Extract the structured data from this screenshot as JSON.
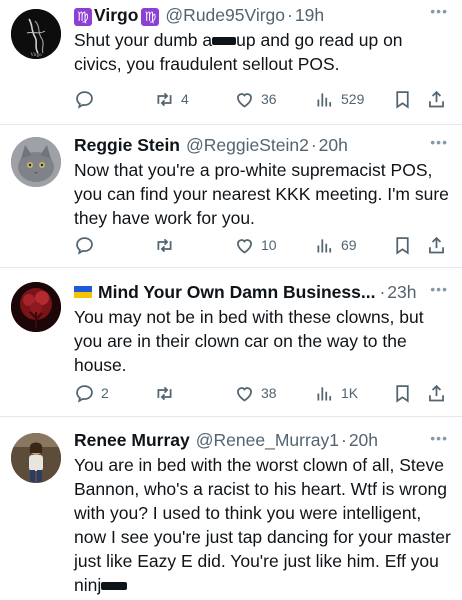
{
  "tweets": [
    {
      "name": "Virgo",
      "handle": "@Rude95Virgo",
      "time": "19h",
      "text_parts": [
        "Shut your dumb a",
        "up and go read up on civics, you fraudulent sellout POS."
      ],
      "replies": "",
      "retweets": "4",
      "likes": "36",
      "views": "529",
      "avatar_text": "Virgo"
    },
    {
      "name": "Reggie Stein",
      "handle": "@ReggieStein2",
      "time": "20h",
      "text": "Now that you're a pro-white supremacist POS, you can find your nearest KKK meeting. I'm sure they have work for you.",
      "replies": "",
      "retweets": "",
      "likes": "10",
      "views": "69"
    },
    {
      "name": "Mind Your Own Damn Business...",
      "handle": "",
      "time": "23h",
      "text": "You may not be in bed with these clowns, but you are in their clown car on the way to the house.",
      "replies": "2",
      "retweets": "",
      "likes": "38",
      "views": "1K"
    },
    {
      "name": "Renee Murray",
      "handle": "@Renee_Murray1",
      "time": "20h",
      "text_parts": [
        "You are in bed with the worst clown of all, Steve Bannon, who's a racist to his heart.  Wtf is wrong with you? I used to think you were intelligent, now I see you're just tap dancing for your master just like Eazy E did.  You're just like him.  ",
        "E",
        "ff you",
        " ni",
        "nj"
      ]
    }
  ],
  "ui": {
    "sep": "·",
    "more": "•••"
  },
  "colors": {
    "text": "#0f1419",
    "muted": "#536471",
    "zodiac": "#8d3fd3"
  },
  "icons": [
    "reply-icon",
    "retweet-icon",
    "like-icon",
    "views-icon",
    "bookmark-icon",
    "share-icon",
    "zodiac-virgo-icon",
    "ukraine-flag-icon"
  ]
}
